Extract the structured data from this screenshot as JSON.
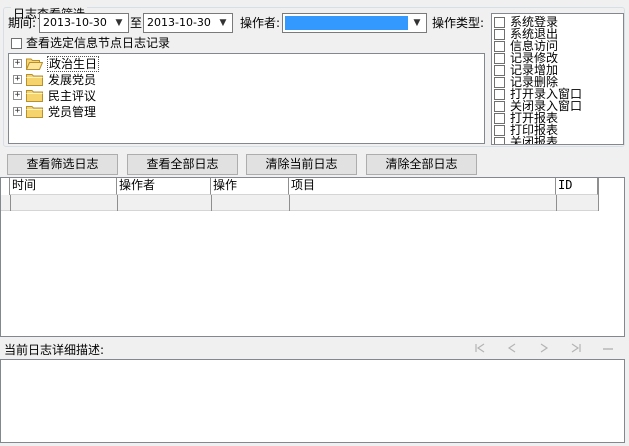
{
  "filter": {
    "group_title": "日志查看筛选",
    "period_label": "期间:",
    "date_from": "2013-10-30",
    "to_label": "至",
    "date_to": "2013-10-30",
    "operator_label": "操作者:",
    "operator_value": "",
    "op_type_label": "操作类型:",
    "node_only_label": "查看选定信息节点日志记录",
    "node_only_checked": false
  },
  "tree": {
    "nodes": [
      {
        "label": "政治生日",
        "expanded": false,
        "selected": true,
        "folder": "open"
      },
      {
        "label": "发展党员",
        "expanded": false,
        "selected": false,
        "folder": "closed"
      },
      {
        "label": "民主评议",
        "expanded": false,
        "selected": false,
        "folder": "closed"
      },
      {
        "label": "党员管理",
        "expanded": false,
        "selected": false,
        "folder": "closed"
      }
    ]
  },
  "op_types": [
    {
      "label": "系统登录",
      "checked": false
    },
    {
      "label": "系统退出",
      "checked": false
    },
    {
      "label": "信息访问",
      "checked": false
    },
    {
      "label": "记录修改",
      "checked": false
    },
    {
      "label": "记录增加",
      "checked": false
    },
    {
      "label": "记录删除",
      "checked": false
    },
    {
      "label": "打开录入窗口",
      "checked": false
    },
    {
      "label": "关闭录入窗口",
      "checked": false
    },
    {
      "label": "打开报表",
      "checked": false
    },
    {
      "label": "打印报表",
      "checked": false
    },
    {
      "label": "关闭报表",
      "checked": false
    }
  ],
  "buttons": {
    "view_filtered": "查看筛选日志",
    "view_all": "查看全部日志",
    "clear_current": "清除当前日志",
    "clear_all": "清除全部日志"
  },
  "log_table": {
    "columns": [
      "时间",
      "操作者",
      "操作",
      "项目",
      "ID"
    ],
    "rows": []
  },
  "detail": {
    "label": "当前日志详细描述:",
    "text": ""
  },
  "navigator": {
    "icons": [
      "first-record-icon",
      "prior-record-icon",
      "next-record-icon",
      "last-record-icon",
      "delete-record-icon"
    ],
    "enabled": false
  },
  "colors": {
    "window_bg": "#f0f0f0",
    "selection_blue": "#3399ff",
    "folder_yellow": "#f5d46d"
  }
}
